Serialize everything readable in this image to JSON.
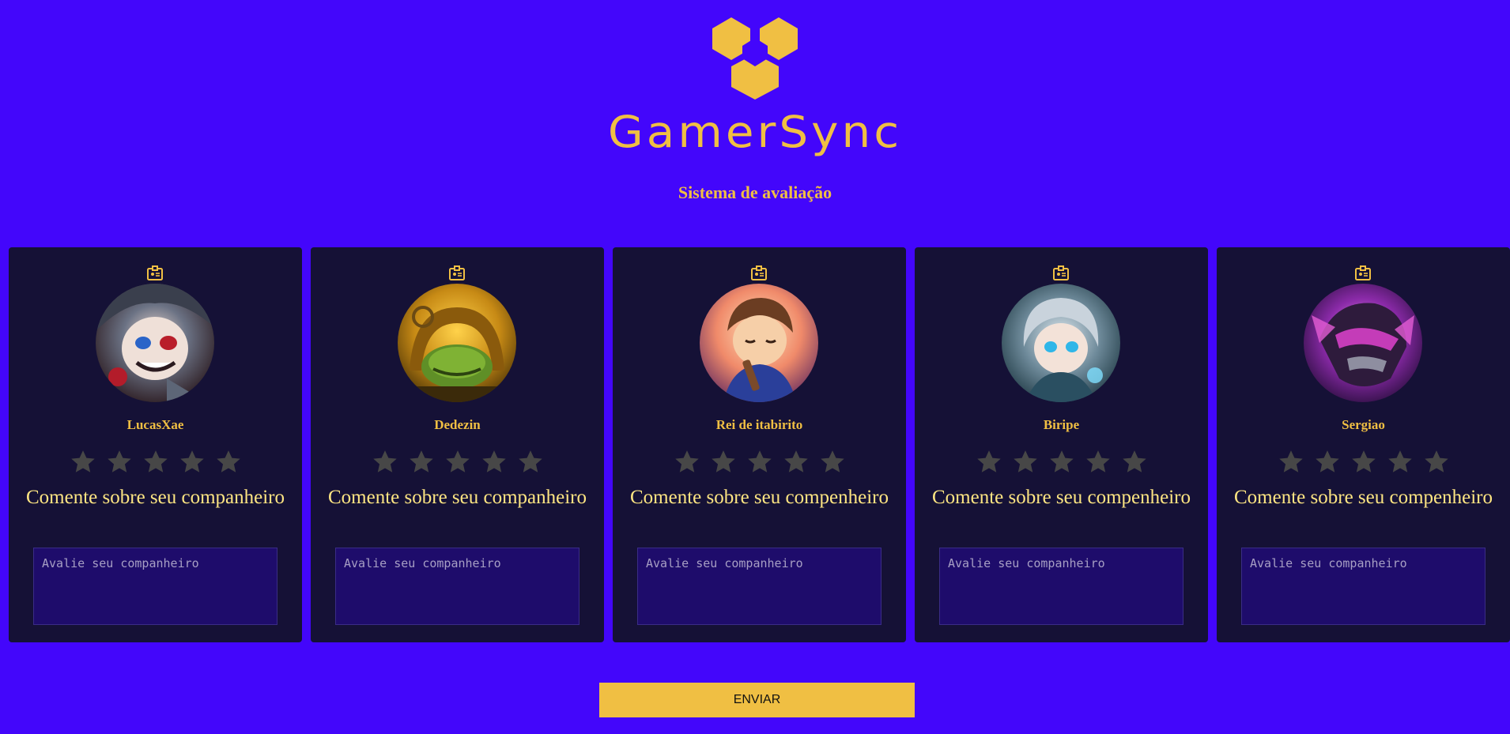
{
  "brand": {
    "name": "GamerSync",
    "logo_icon": "hexagon-cube-logo",
    "accent_color": "#f0bf43",
    "background_color": "#4306fb"
  },
  "page": {
    "title": "Sistema de avaliação"
  },
  "cards": [
    {
      "name": "LucasXae",
      "badge_icon": "id-badge-icon",
      "rating": 0,
      "max_rating": 5,
      "comment_label": "Comente sobre seu companheiro",
      "comment_placeholder": "Avalie seu companheiro",
      "avatar_icon": "champion-avatar"
    },
    {
      "name": "Dedezin",
      "badge_icon": "id-badge-icon",
      "rating": 0,
      "max_rating": 5,
      "comment_label": "Comente sobre seu companheiro",
      "comment_placeholder": "Avalie seu companheiro",
      "avatar_icon": "champion-avatar"
    },
    {
      "name": "Rei de itabirito",
      "badge_icon": "id-badge-icon",
      "rating": 0,
      "max_rating": 5,
      "comment_label": "Comente sobre seu compenheiro",
      "comment_placeholder": "Avalie seu companheiro",
      "avatar_icon": "champion-avatar"
    },
    {
      "name": "Biripe",
      "badge_icon": "id-badge-icon",
      "rating": 0,
      "max_rating": 5,
      "comment_label": "Comente sobre seu compenheiro",
      "comment_placeholder": "Avalie seu companheiro",
      "avatar_icon": "champion-avatar"
    },
    {
      "name": "Sergiao",
      "badge_icon": "id-badge-icon",
      "rating": 0,
      "max_rating": 5,
      "comment_label": "Comente sobre seu compenheiro",
      "comment_placeholder": "Avalie seu companheiro",
      "avatar_icon": "champion-avatar"
    }
  ],
  "submit": {
    "label": "ENVIAR"
  }
}
